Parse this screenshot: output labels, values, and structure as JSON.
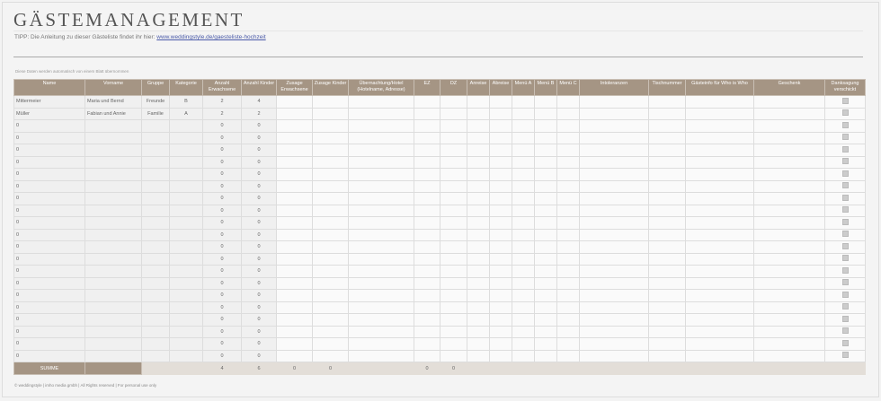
{
  "title": "GÄSTEMANAGEMENT",
  "tip_text": "TIPP: Die Anleitung zu dieser Gästeliste findet ihr hier: ",
  "tip_link": "www.weddingstyle.de/gaesteliste-hochzeit",
  "note": "Diese Daten werden automatisch von einem Blatt übernommen",
  "columns": [
    "Name",
    "Vorname",
    "Gruppe",
    "Kategorie",
    "Anzahl Erwachsene",
    "Anzahl Kinder",
    "Zusage Erwachsene",
    "Zusage Kinder",
    "Übernachtung/Hotel (Hotelname, Adresse)",
    "EZ",
    "DZ",
    "Anreise",
    "Abreise",
    "Menü A",
    "Menü B",
    "Menü C",
    "Intoleranzen",
    "Tischnummer",
    "Gästeinfo für Who is Who",
    "Geschenk",
    "Danksagung verschickt"
  ],
  "rows": [
    {
      "name": "Mittermeier",
      "vorname": "Maria und Bernd",
      "gruppe": "Freunde",
      "kategorie": "B",
      "erw": "2",
      "kinder": "4"
    },
    {
      "name": "Müller",
      "vorname": "Fabian und Annie",
      "gruppe": "Familie",
      "kategorie": "A",
      "erw": "2",
      "kinder": "2"
    },
    {
      "name": "0",
      "erw": "0",
      "kinder": "0"
    },
    {
      "name": "0",
      "erw": "0",
      "kinder": "0"
    },
    {
      "name": "0",
      "erw": "0",
      "kinder": "0"
    },
    {
      "name": "0",
      "erw": "0",
      "kinder": "0"
    },
    {
      "name": "0",
      "erw": "0",
      "kinder": "0"
    },
    {
      "name": "0",
      "erw": "0",
      "kinder": "0"
    },
    {
      "name": "0",
      "erw": "0",
      "kinder": "0"
    },
    {
      "name": "0",
      "erw": "0",
      "kinder": "0"
    },
    {
      "name": "0",
      "erw": "0",
      "kinder": "0"
    },
    {
      "name": "0",
      "erw": "0",
      "kinder": "0"
    },
    {
      "name": "0",
      "erw": "0",
      "kinder": "0"
    },
    {
      "name": "0",
      "erw": "0",
      "kinder": "0"
    },
    {
      "name": "0",
      "erw": "0",
      "kinder": "0"
    },
    {
      "name": "0",
      "erw": "0",
      "kinder": "0"
    },
    {
      "name": "0",
      "erw": "0",
      "kinder": "0"
    },
    {
      "name": "0",
      "erw": "0",
      "kinder": "0"
    },
    {
      "name": "0",
      "erw": "0",
      "kinder": "0"
    },
    {
      "name": "0",
      "erw": "0",
      "kinder": "0"
    },
    {
      "name": "0",
      "erw": "0",
      "kinder": "0"
    },
    {
      "name": "0",
      "erw": "0",
      "kinder": "0"
    }
  ],
  "summe": {
    "label": "SUMME",
    "erw": "4",
    "kinder": "6",
    "zus_erw": "0",
    "zus_kinder": "0",
    "ez": "0",
    "dz": "0"
  },
  "footer": "© weddingstyle | imho media gmbh | All Rights reserved | For personal use only"
}
